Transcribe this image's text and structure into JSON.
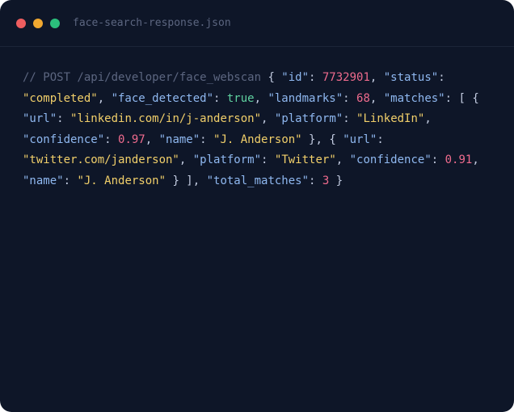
{
  "window": {
    "filename": "face-search-response.json",
    "dots": [
      {
        "name": "close",
        "color": "#ee5d5f"
      },
      {
        "name": "minimize",
        "color": "#f0a830"
      },
      {
        "name": "maximize",
        "color": "#2bbf7c"
      }
    ]
  },
  "colors": {
    "background": "#0e1628",
    "comment": "#5c6680",
    "key": "#8fb8f0",
    "string": "#f1cf6a",
    "number": "#ee6b8d",
    "boolean": "#5fd1a0",
    "punctuation": "#c2cbe0"
  },
  "code": {
    "tokens": [
      {
        "t": "comment",
        "v": "// POST /api/developer/face_webscan "
      },
      {
        "t": "punctuation",
        "v": "{ "
      },
      {
        "t": "key",
        "v": "\"id\""
      },
      {
        "t": "punctuation",
        "v": ": "
      },
      {
        "t": "number",
        "v": "7732901"
      },
      {
        "t": "punctuation",
        "v": ", "
      },
      {
        "t": "key",
        "v": "\"status\""
      },
      {
        "t": "punctuation",
        "v": ": "
      },
      {
        "t": "string",
        "v": "\"completed\""
      },
      {
        "t": "punctuation",
        "v": ", "
      },
      {
        "t": "key",
        "v": "\"face_detected\""
      },
      {
        "t": "punctuation",
        "v": ": "
      },
      {
        "t": "boolean",
        "v": "true"
      },
      {
        "t": "punctuation",
        "v": ", "
      },
      {
        "t": "key",
        "v": "\"landmarks\""
      },
      {
        "t": "punctuation",
        "v": ": "
      },
      {
        "t": "number",
        "v": "68"
      },
      {
        "t": "punctuation",
        "v": ", "
      },
      {
        "t": "key",
        "v": "\"matches\""
      },
      {
        "t": "punctuation",
        "v": ": [ { "
      },
      {
        "t": "key",
        "v": "\"url\""
      },
      {
        "t": "punctuation",
        "v": ": "
      },
      {
        "t": "string",
        "v": "\"linkedin.com/in/j-anderson\""
      },
      {
        "t": "punctuation",
        "v": ", "
      },
      {
        "t": "key",
        "v": "\"platform\""
      },
      {
        "t": "punctuation",
        "v": ": "
      },
      {
        "t": "string",
        "v": "\"LinkedIn\""
      },
      {
        "t": "punctuation",
        "v": ", "
      },
      {
        "t": "key",
        "v": "\"confidence\""
      },
      {
        "t": "punctuation",
        "v": ": "
      },
      {
        "t": "number",
        "v": "0.97"
      },
      {
        "t": "punctuation",
        "v": ", "
      },
      {
        "t": "key",
        "v": "\"name\""
      },
      {
        "t": "punctuation",
        "v": ": "
      },
      {
        "t": "string",
        "v": "\"J. Anderson\""
      },
      {
        "t": "punctuation",
        "v": " }, { "
      },
      {
        "t": "key",
        "v": "\"url\""
      },
      {
        "t": "punctuation",
        "v": ": "
      },
      {
        "t": "string",
        "v": "\"twitter.com/janderson\""
      },
      {
        "t": "punctuation",
        "v": ", "
      },
      {
        "t": "key",
        "v": "\"platform\""
      },
      {
        "t": "punctuation",
        "v": ": "
      },
      {
        "t": "string",
        "v": "\"Twitter\""
      },
      {
        "t": "punctuation",
        "v": ", "
      },
      {
        "t": "key",
        "v": "\"confidence\""
      },
      {
        "t": "punctuation",
        "v": ": "
      },
      {
        "t": "number",
        "v": "0.91"
      },
      {
        "t": "punctuation",
        "v": ", "
      },
      {
        "t": "key",
        "v": "\"name\""
      },
      {
        "t": "punctuation",
        "v": ": "
      },
      {
        "t": "string",
        "v": "\"J. Anderson\""
      },
      {
        "t": "punctuation",
        "v": " } ], "
      },
      {
        "t": "key",
        "v": "\"total_matches\""
      },
      {
        "t": "punctuation",
        "v": ": "
      },
      {
        "t": "number",
        "v": "3"
      },
      {
        "t": "punctuation",
        "v": " }"
      }
    ]
  }
}
